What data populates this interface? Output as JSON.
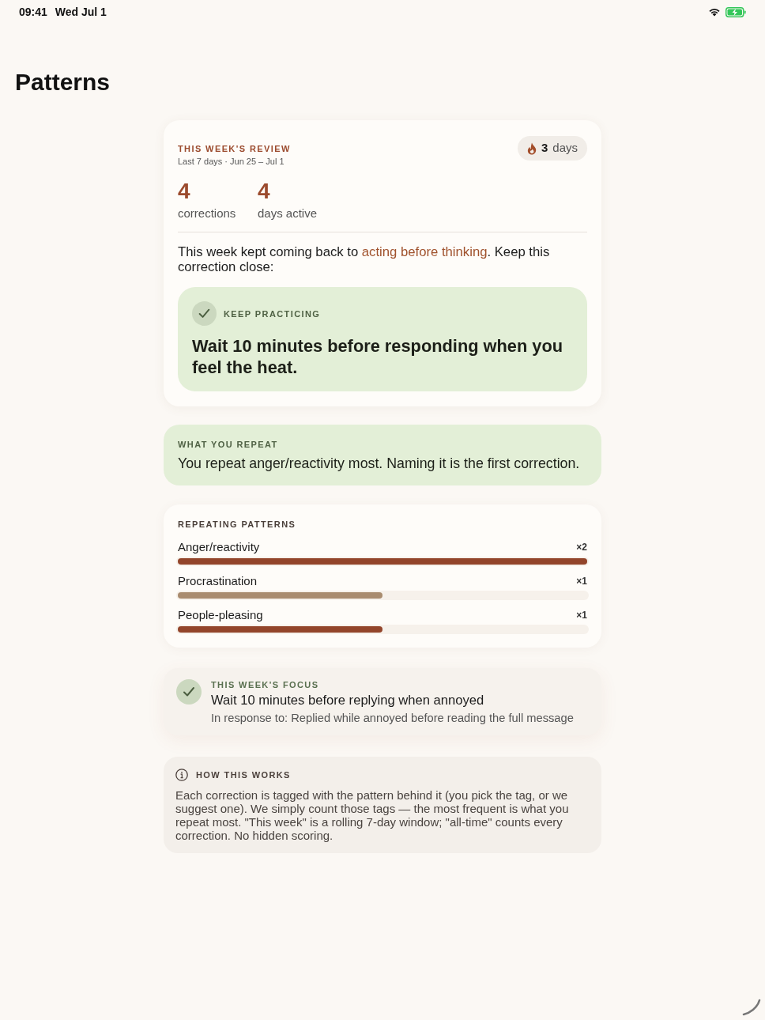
{
  "status_bar": {
    "time": "09:41",
    "date": "Wed Jul 1"
  },
  "title": "Patterns",
  "weekly_review": {
    "label": "THIS WEEK'S REVIEW",
    "range": "Last 7 days · Jun 25 – Jul 1",
    "streak": {
      "count": "3",
      "unit": "days"
    },
    "stats": [
      {
        "value": "4",
        "label": "corrections"
      },
      {
        "value": "4",
        "label": "days active"
      }
    ],
    "summary": {
      "before": "This week kept coming back to ",
      "highlight": "acting before thinking",
      "after": ". Keep this correction close:"
    },
    "practice": {
      "label": "KEEP PRACTICING",
      "text": "Wait 10 minutes before responding when you feel the heat."
    }
  },
  "what_you_repeat": {
    "label": "WHAT YOU REPEAT",
    "text": "You repeat anger/reactivity most. Naming it is the first correction."
  },
  "repeating_patterns": {
    "label": "REPEATING PATTERNS",
    "items": [
      {
        "name": "Anger/reactivity",
        "count": "×2",
        "level": 1,
        "color": "#93452b"
      },
      {
        "name": "Procrastination",
        "count": "×1",
        "level": 0.5,
        "color": "#a98c6f"
      },
      {
        "name": "People-pleasing",
        "count": "×1",
        "level": 0.5,
        "color": "#93452b"
      }
    ]
  },
  "focus": {
    "label": "THIS WEEK'S FOCUS",
    "title": "Wait 10 minutes before replying when annoyed",
    "context": "In response to: Replied while annoyed before reading the full message"
  },
  "how_it_works": {
    "title": "HOW THIS WORKS",
    "text": "Each correction is tagged with the pattern behind it (you pick the tag, or we suggest one). We simply count those tags — the most frequent is what you repeat most. \"This week\" is a rolling 7-day window; \"all-time\" counts every correction. No hidden scoring."
  }
}
